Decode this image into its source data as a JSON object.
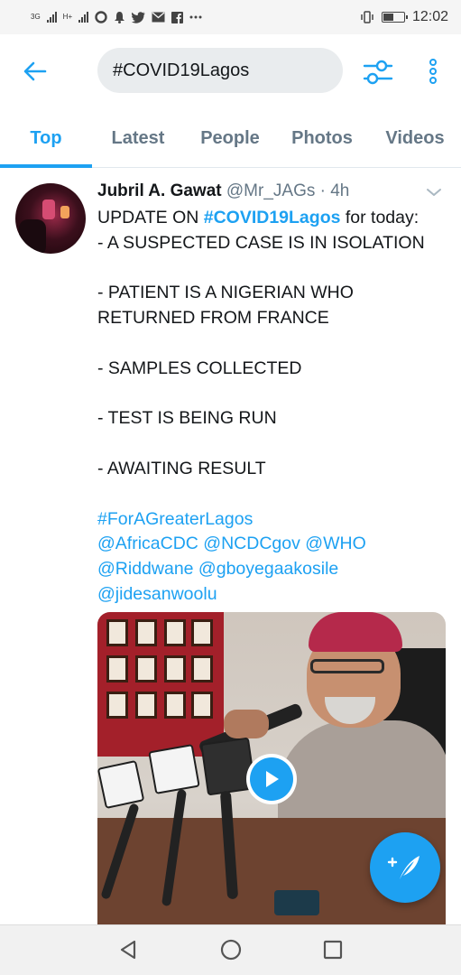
{
  "status_bar": {
    "network_1": "3G",
    "network_2": "H+",
    "time": "12:02",
    "battery_level": 0.5,
    "notification_icons": [
      "opera-icon",
      "notification-bell-icon",
      "twitter-icon",
      "mail-icon",
      "facebook-icon",
      "more-dots-icon"
    ]
  },
  "header": {
    "search_value": "#COVID19Lagos"
  },
  "tabs": [
    {
      "label": "Top",
      "active": true
    },
    {
      "label": "Latest",
      "active": false
    },
    {
      "label": "People",
      "active": false
    },
    {
      "label": "Photos",
      "active": false
    },
    {
      "label": "Videos",
      "active": false
    }
  ],
  "tweet": {
    "display_name": "Jubril A. Gawat",
    "handle_meta": "@Mr_JAGs · 4h",
    "line1_prefix": "UPDATE ON ",
    "line1_hashtag": "#COVID19Lagos",
    "line1_suffix": " for today:",
    "line2": "- A SUSPECTED CASE IS IN ISOLATION",
    "line4": "- PATIENT IS A NIGERIAN WHO",
    "line5": "RETURNED FROM FRANCE",
    "line7": "- SAMPLES COLLECTED",
    "line9": "- TEST IS BEING RUN",
    "line11": "- AWAITING RESULT",
    "hashtag2": "#ForAGreaterLagos",
    "mentions_line1": "@AfricaCDC @NCDCgov @WHO",
    "mentions_line2": "@Riddwane @gboyegaakosile",
    "mentions_line3": "@jidesanwoolu"
  },
  "colors": {
    "accent": "#1da1f2",
    "text": "#14171a",
    "secondary": "#657786"
  }
}
